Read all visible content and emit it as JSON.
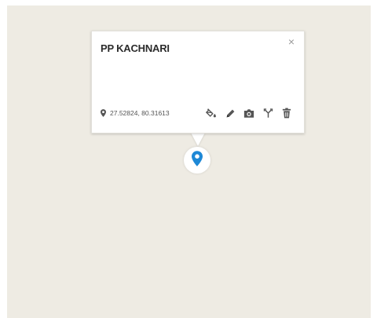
{
  "map": {
    "background_color": "#eeebe3"
  },
  "popup": {
    "title": "PP KACHNARI",
    "close_symbol": "×",
    "coordinates": "27.52824, 80.31613",
    "coordinate_icon": "location-pin-icon",
    "actions": [
      {
        "name": "fill-color-icon"
      },
      {
        "name": "edit-pencil-icon"
      },
      {
        "name": "camera-icon"
      },
      {
        "name": "route-fork-icon"
      },
      {
        "name": "trash-icon"
      }
    ]
  },
  "marker": {
    "icon": "location-pin-icon",
    "color": "#1e88d6"
  }
}
